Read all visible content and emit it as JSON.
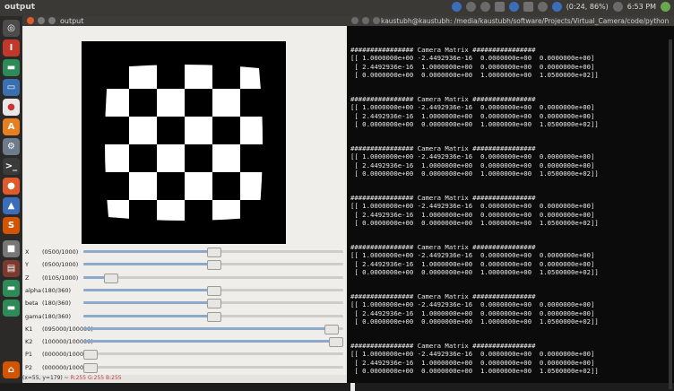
{
  "topbar": {
    "title": "output",
    "battery": "(0:24, 86%)",
    "clock": "6:53 PM"
  },
  "window": {
    "title": "output"
  },
  "trackbars": [
    {
      "name": "X",
      "value": "(0500/1000)",
      "level": 0.5
    },
    {
      "name": "Y",
      "value": "(0500/1000)",
      "level": 0.5
    },
    {
      "name": "Z",
      "value": "(0105/1000)",
      "level": 0.105
    },
    {
      "name": "alpha",
      "value": "(180/360)",
      "level": 0.5
    },
    {
      "name": "beta",
      "value": "(180/360)",
      "level": 0.5
    },
    {
      "name": "gama",
      "value": "(180/360)",
      "level": 0.5
    },
    {
      "name": "K1",
      "value": "(095000/100000)",
      "level": 0.95
    },
    {
      "name": "K2",
      "value": "(100000/100000)",
      "level": 1.0
    },
    {
      "name": "P1",
      "value": "(000000/100000)",
      "level": 0.0
    },
    {
      "name": "P2",
      "value": "(000000/100000)",
      "level": 0.0
    }
  ],
  "status": {
    "coords": "(x=55, y=179) ~",
    "rgb": "R:255 G:255 B:255"
  },
  "terminal": {
    "title": "kaustubh@kaustubh: /media/kaustubh/software/Projects/Virtual_Camera/code/python",
    "heading": "################ Camera Matrix ################",
    "rows": [
      "[[ 1.0000000e+00 -2.4492936e-16  0.0000000e+00  0.0000000e+00]",
      " [ 2.4492936e-16  1.0000000e+00  0.0000000e+00  0.0000000e+00]",
      " [ 0.0000000e+00  0.0000000e+00  1.0000000e+00  1.0500000e+02]]"
    ]
  },
  "launcher_icons": [
    "dash-icon",
    "ubuntu-icon",
    "files-icon",
    "browser-icon",
    "chrome-icon",
    "software-center-icon",
    "settings-icon",
    "terminal-icon",
    "firefox-icon",
    "app-icon",
    "sublime-icon",
    "app2-icon",
    "app3-icon",
    "app4-icon",
    "trash-icon"
  ]
}
